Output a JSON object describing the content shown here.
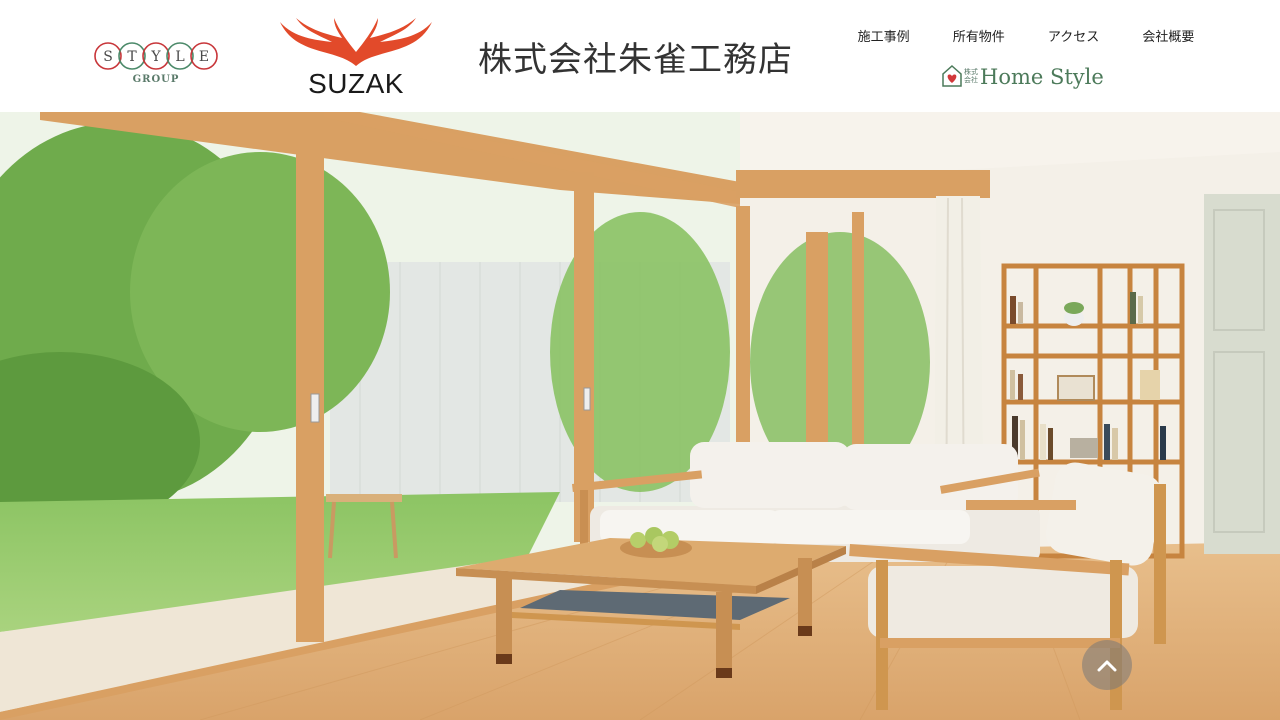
{
  "header": {
    "style_group": {
      "letters": [
        "S",
        "T",
        "Y",
        "L",
        "E"
      ],
      "sub_label": "GROUP",
      "ring_colors": [
        "#c8363a",
        "#4c8a6a"
      ]
    },
    "suzak": {
      "text": "SUZAK",
      "wing_color": "#e24a2a"
    },
    "company_name": "株式会社朱雀工務店",
    "nav": [
      {
        "label": "施工事例"
      },
      {
        "label": "所有物件"
      },
      {
        "label": "アクセス"
      },
      {
        "label": "会社概要"
      }
    ],
    "homestyle": {
      "corp_label": "株式会社",
      "name": "Home Style",
      "color": "#4c7a5a"
    }
  },
  "hero": {
    "image_subject": "bright living room with wooden frame glass doors, white sofa, wooden coffee table with fruit bowl, bookshelf and garden view",
    "colors": {
      "wood": "#d9a063",
      "wall": "#f4f0e8",
      "floor": "#e0b27c",
      "greenery": "#6aa84f"
    }
  },
  "back_to_top": {
    "icon": "chevron-up-icon"
  }
}
